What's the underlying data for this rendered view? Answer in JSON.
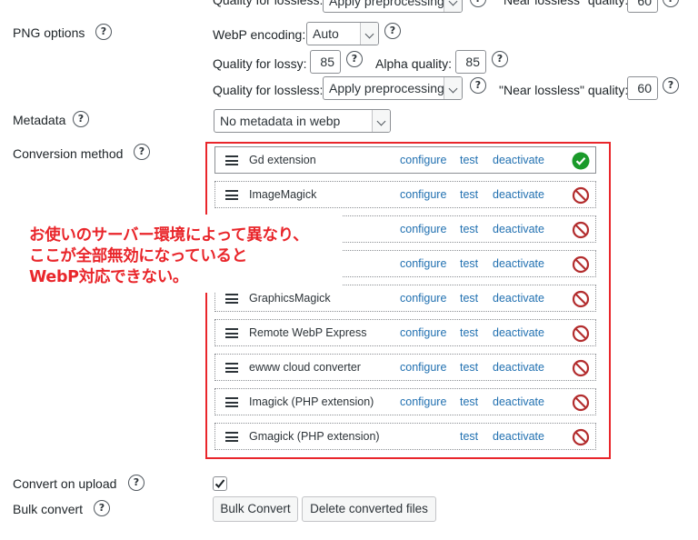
{
  "top_partial": {
    "quality_label": "Quality for lossless:",
    "quality_value": "Apply preprocessing",
    "near_label": "\"Near lossless\" quality:",
    "near_value": "60"
  },
  "png": {
    "label": "PNG options",
    "encoding_label": "WebP encoding:",
    "encoding_value": "Auto",
    "lossy_label": "Quality for lossy:",
    "lossy_value": "85",
    "alpha_label": "Alpha quality:",
    "alpha_value": "85",
    "lossless_label": "Quality for lossless:",
    "lossless_value": "Apply preprocessing",
    "near_label": "\"Near lossless\" quality:",
    "near_value": "60"
  },
  "metadata": {
    "label": "Metadata",
    "value": "No metadata in webp"
  },
  "conversion": {
    "label": "Conversion method",
    "configure": "configure",
    "test": "test",
    "deactivate": "deactivate",
    "methods": [
      {
        "name": "Gd extension",
        "status": "ok"
      },
      {
        "name": "ImageMagick",
        "status": "blocked"
      },
      {
        "name": "",
        "status": "blocked"
      },
      {
        "name": "",
        "status": "blocked"
      },
      {
        "name": "GraphicsMagick",
        "status": "blocked"
      },
      {
        "name": "Remote WebP Express",
        "status": "blocked"
      },
      {
        "name": "ewww cloud converter",
        "status": "blocked"
      },
      {
        "name": "Imagick (PHP extension)",
        "status": "blocked"
      },
      {
        "name": "Gmagick (PHP extension)",
        "status": "blocked"
      }
    ]
  },
  "annotation": {
    "lines": [
      "お使いのサーバー環境によって異なり、",
      "ここが全部無効になっていると",
      "WebP対応できない。"
    ],
    "color": "#e9262b"
  },
  "upload": {
    "label": "Convert on upload",
    "checked": true
  },
  "bulk": {
    "label": "Bulk convert",
    "convert_button": "Bulk Convert",
    "delete_button": "Delete converted files"
  },
  "help_glyph": "?",
  "colors": {
    "link": "#2271b1",
    "ok": "#1a9a2a",
    "blocked": "#b32d2e",
    "highlight": "#e9262b"
  }
}
